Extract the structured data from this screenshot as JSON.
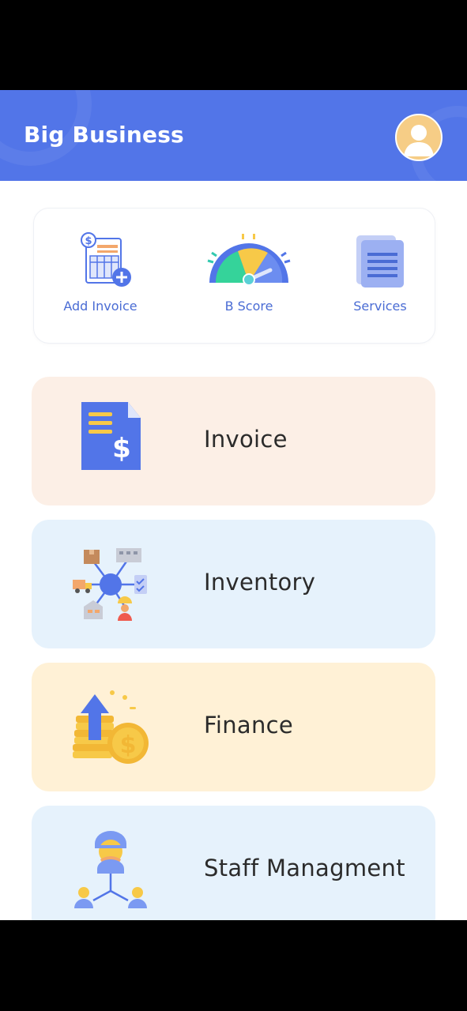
{
  "app": {
    "title": "Big Business"
  },
  "quick_actions": [
    {
      "label": "Add Invoice",
      "icon": "add-invoice-icon"
    },
    {
      "label": "B Score",
      "icon": "score-gauge-icon"
    },
    {
      "label": "Services",
      "icon": "documents-icon"
    }
  ],
  "menu": [
    {
      "label": "Invoice",
      "icon": "invoice-dollar-icon",
      "bg": "#fcefe6"
    },
    {
      "label": "Inventory",
      "icon": "inventory-network-icon",
      "bg": "#e6f2fc"
    },
    {
      "label": "Finance",
      "icon": "finance-coins-icon",
      "bg": "#fff1d6"
    },
    {
      "label": "Staff Managment",
      "icon": "staff-team-icon",
      "bg": "#e6f2fc"
    }
  ],
  "colors": {
    "primary": "#5275e8",
    "label_blue": "#4a6cd4"
  }
}
